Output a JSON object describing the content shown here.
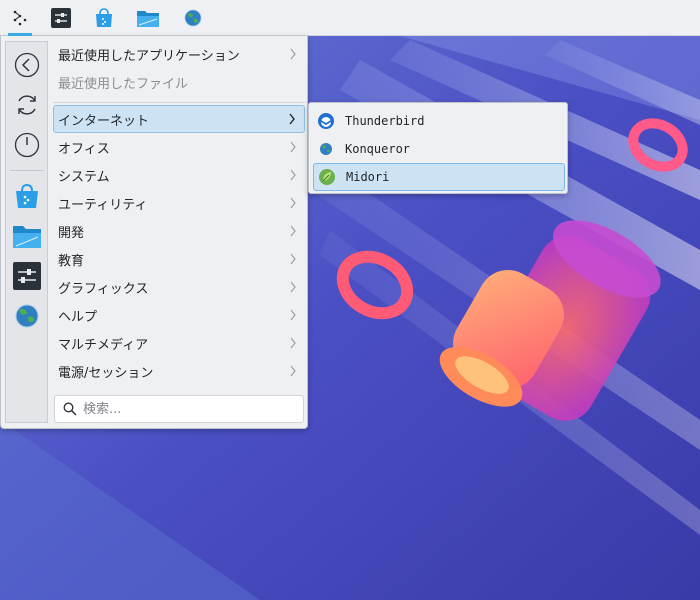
{
  "panel": {
    "launcher_icon": "kickoff-launcher-icon",
    "pinned": [
      {
        "name": "system-settings-icon"
      },
      {
        "name": "discover-store-icon"
      },
      {
        "name": "file-manager-icon"
      },
      {
        "name": "konqueror-globe-icon"
      }
    ]
  },
  "sidebar": {
    "buttons": [
      "back-icon",
      "refresh-icon",
      "power-icon"
    ],
    "favorites": [
      "discover-store-icon",
      "file-manager-icon",
      "system-settings-icon",
      "konqueror-globe-icon"
    ]
  },
  "menu": {
    "recent_apps": "最近使用したアプリケーション",
    "recent_files": "最近使用したファイル",
    "categories": [
      "インターネット",
      "オフィス",
      "システム",
      "ユーティリティ",
      "開発",
      "教育",
      "グラフィックス",
      "ヘルプ",
      "マルチメディア",
      "電源/セッション"
    ],
    "selected_category": "インターネット"
  },
  "search": {
    "placeholder": "検索..."
  },
  "submenu": {
    "items": [
      "Thunderbird",
      "Konqueror",
      "Midori"
    ],
    "selected": "Midori"
  },
  "colors": {
    "accent": "#3daee9",
    "selection_bg": "#cde3f4",
    "menu_bg": "#eff0f1"
  }
}
